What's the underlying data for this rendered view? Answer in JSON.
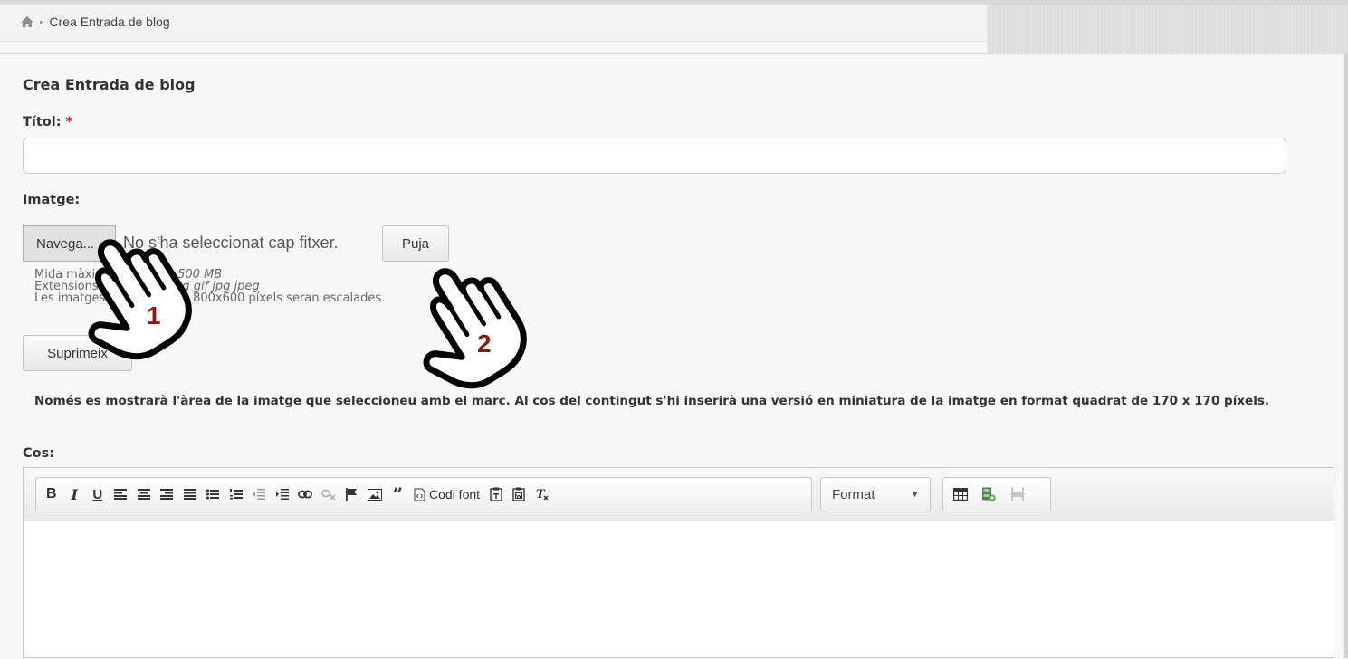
{
  "breadcrumb": {
    "home_icon": "home-icon",
    "separator": "▸",
    "current": "Crea Entrada de blog"
  },
  "page_title": "Crea Entrada de blog",
  "form": {
    "title_label": "Títol:",
    "required_mark": "*",
    "title_value": "",
    "image_label": "Imatge:",
    "browse_label": "Navega...",
    "file_status": "No s'ha seleccionat cap fitxer.",
    "upload_label": "Puja",
    "help": {
      "max_size_prefix": "Mida màxima del fitxer: ",
      "max_size_value": "500 MB",
      "ext_prefix": "Extensions permeses: ",
      "ext_value": "png gif jpg jpeg",
      "scale_note": "Les imatges més grans de 800x600 píxels seran escalades."
    },
    "delete_label": "Suprimeix",
    "notice": "Només es mostrarà l'àrea de la imatge que seleccioneu amb el marc. Al cos del contingut s'hi inserirà una versió en miniatura de la imatge en format quadrat de 170 x 170 píxels.",
    "body_label": "Cos:"
  },
  "editor": {
    "source_label": "Codi font",
    "format_label": "Format",
    "toolbar_icons": [
      "bold-icon",
      "italic-icon",
      "underline-icon",
      "align-left-icon",
      "align-center-icon",
      "align-right-icon",
      "justify-icon",
      "bulleted-list-icon",
      "numbered-list-icon",
      "outdent-icon",
      "indent-icon",
      "link-icon",
      "unlink-icon",
      "anchor-flag-icon",
      "image-icon",
      "blockquote-icon",
      "source-icon",
      "paste-text-icon",
      "paste-word-icon",
      "remove-format-icon",
      "table-icon",
      "media-icon",
      "page-break-icon"
    ]
  },
  "annotations": {
    "hand_1_number": "1",
    "hand_2_number": "2",
    "hand_color": "#8b1a12"
  }
}
